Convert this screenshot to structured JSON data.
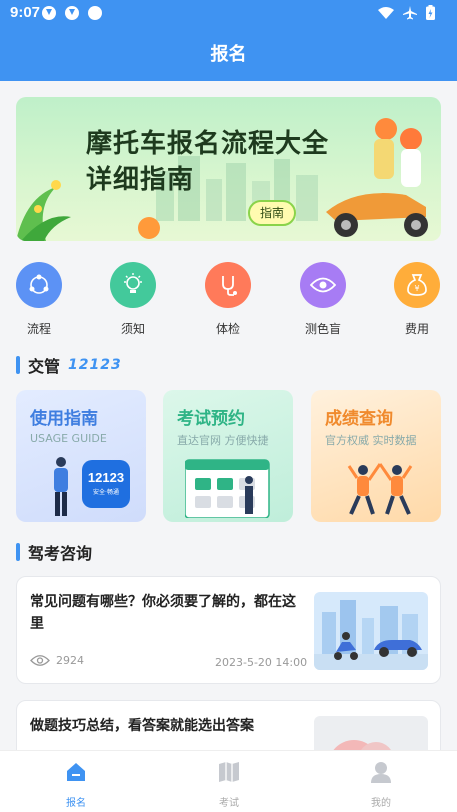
{
  "status": {
    "time": "9:07"
  },
  "header": {
    "title": "报名"
  },
  "banner": {
    "line1": "摩托车报名流程大全",
    "line2": "详细指南",
    "tag": "指南"
  },
  "categories": [
    {
      "label": "流程",
      "icon": "flow-icon",
      "color": "#5c92f5"
    },
    {
      "label": "须知",
      "icon": "lightbulb-icon",
      "color": "#43c99b"
    },
    {
      "label": "体检",
      "icon": "health-check-icon",
      "color": "#ff7a5a"
    },
    {
      "label": "测色盲",
      "icon": "eye-icon",
      "color": "#a77cf4"
    },
    {
      "label": "费用",
      "icon": "money-bag-icon",
      "color": "#ffad3a"
    }
  ],
  "section1": {
    "title": "交管",
    "sub": "12123"
  },
  "cards": [
    {
      "title": "使用指南",
      "sub": "USAGE GUIDE",
      "color": "#3f7ee0",
      "logo": "12123",
      "logo_sub": "安全·畅通"
    },
    {
      "title": "考试预约",
      "sub": "直达官网 方便快捷",
      "color": "#2fb486"
    },
    {
      "title": "成绩查询",
      "sub": "官方权威 实时数据",
      "color": "#f08a2d"
    }
  ],
  "section2": {
    "title": "驾考咨询"
  },
  "news": [
    {
      "title": "常见问题有哪些？你必须要了解的，都在这里",
      "views": "2924",
      "date": "2023-5-20 14:00"
    },
    {
      "title": "做题技巧总结，看答案就能选出答案"
    }
  ],
  "tabs": [
    {
      "label": "报名",
      "icon": "home-icon",
      "active": true
    },
    {
      "label": "考试",
      "icon": "book-icon",
      "active": false
    },
    {
      "label": "我的",
      "icon": "user-icon",
      "active": false
    }
  ]
}
